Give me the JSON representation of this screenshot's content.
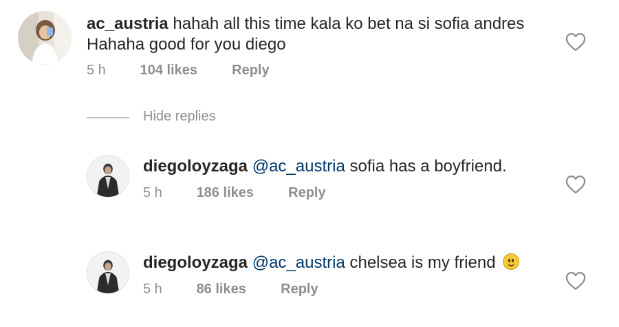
{
  "comment": {
    "username": "ac_austria",
    "text_line1": "hahah all this time kala ko bet na si sofia andres",
    "text_line2": "Hahaha good for you diego",
    "time": "5 h",
    "likes": "104 likes",
    "reply_label": "Reply"
  },
  "hide_replies_label": "Hide replies",
  "replies": [
    {
      "username": "diegoloyzaga",
      "mention": "@ac_austria",
      "text": "sofia has a boyfriend.",
      "time": "5 h",
      "likes": "186 likes",
      "reply_label": "Reply"
    },
    {
      "username": "diegoloyzaga",
      "mention": "@ac_austria",
      "text": "chelsea is my friend",
      "emoji": "slightly-smiling-face-emoji",
      "time": "5 h",
      "likes": "86 likes",
      "reply_label": "Reply"
    }
  ],
  "colors": {
    "text": "#262626",
    "secondary": "#8e8e8e",
    "mention": "#00376b",
    "heart_outline": "#8e8e8e"
  },
  "icons": [
    "heart-outline-icon",
    "avatar-icon"
  ]
}
